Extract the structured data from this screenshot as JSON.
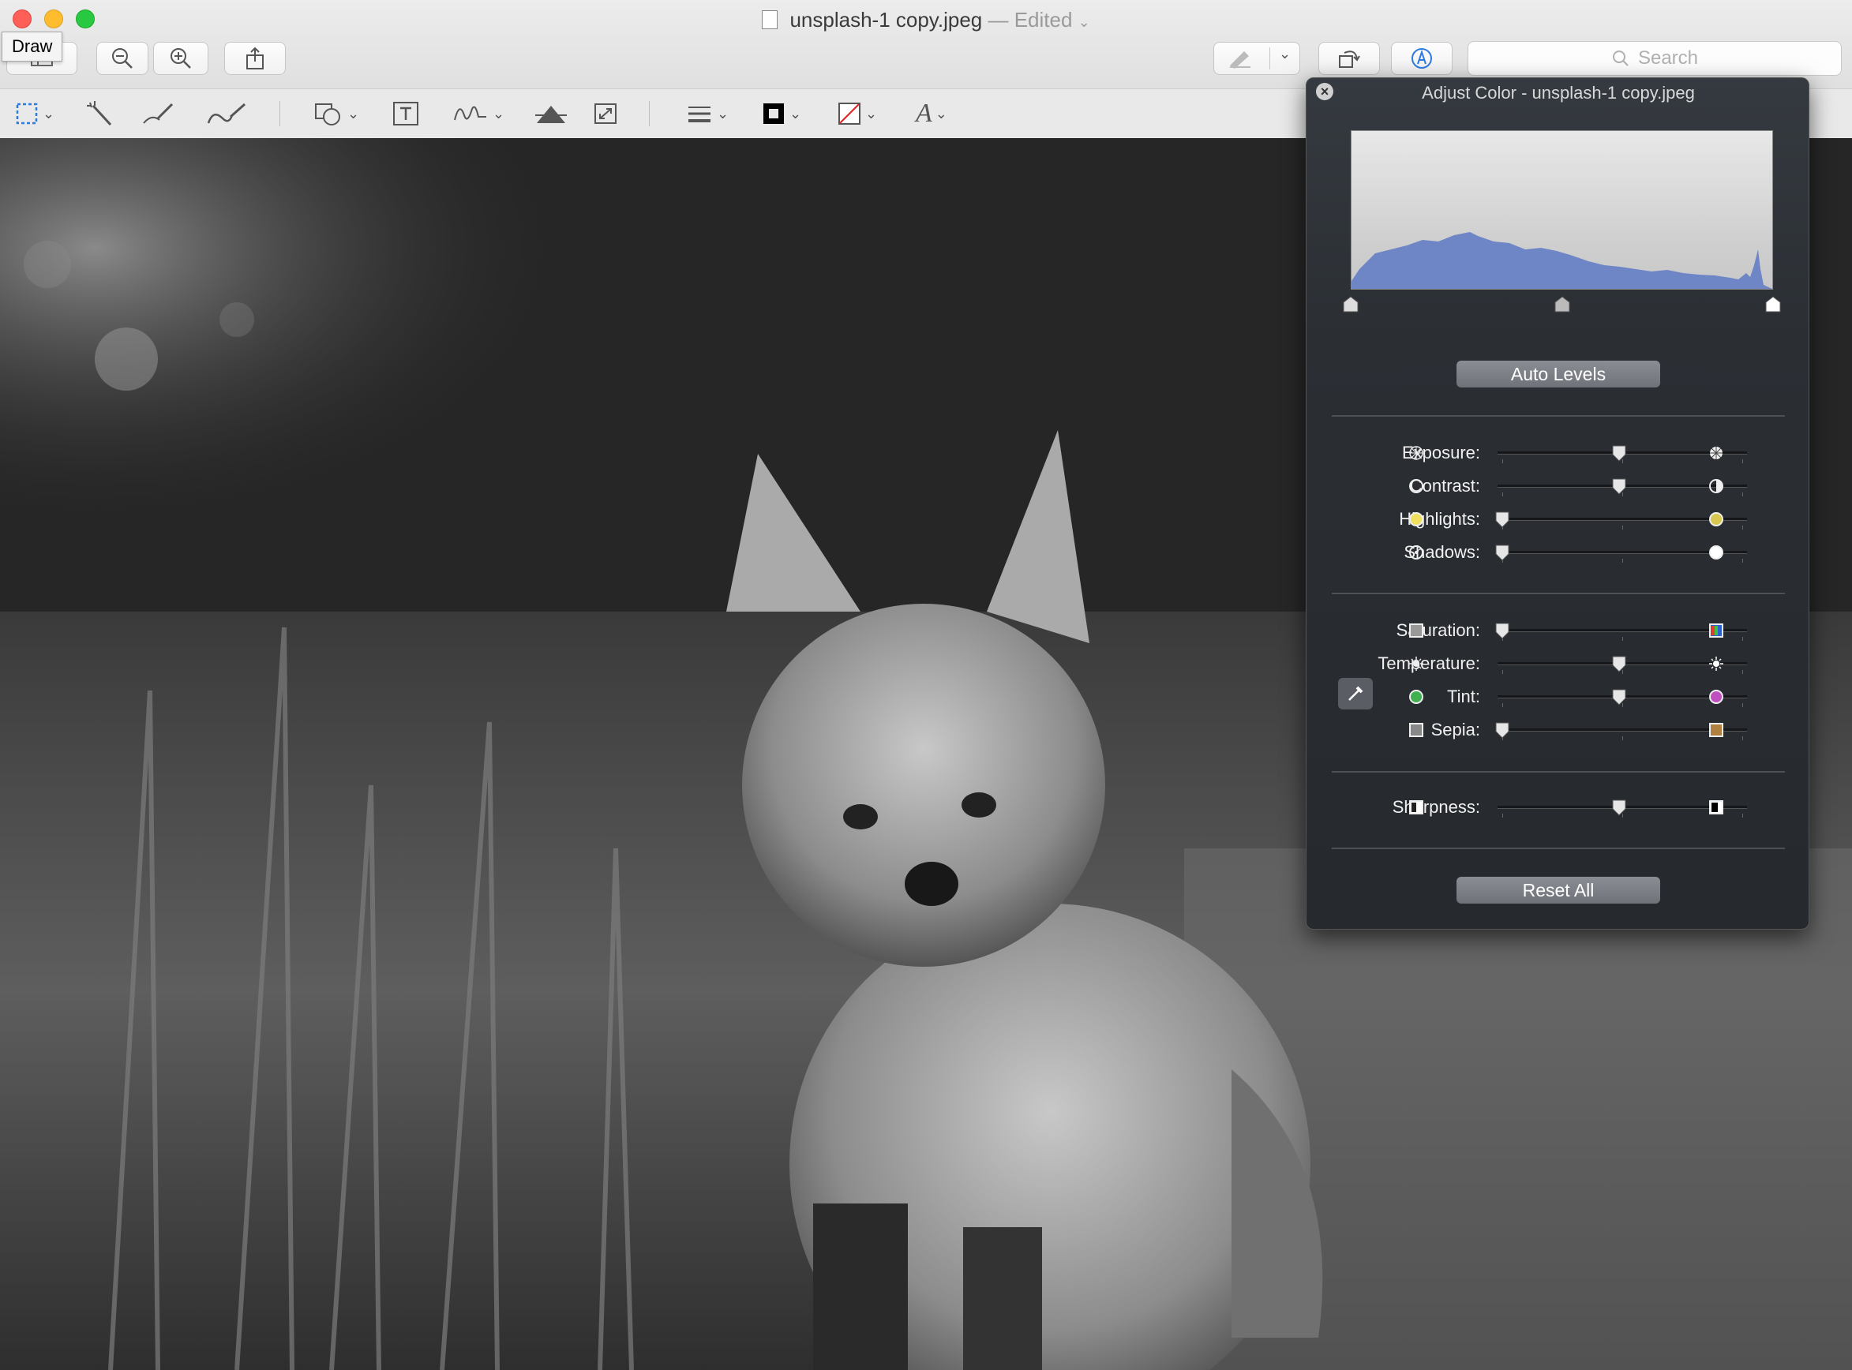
{
  "window": {
    "title": "unsplash-1 copy.jpeg",
    "title_suffix": "— Edited",
    "traffic_colors": [
      "#fe5f57",
      "#febc2e",
      "#28c840"
    ]
  },
  "tooltip": {
    "text": "Draw"
  },
  "toolbar": {
    "search_placeholder": "Search",
    "icons": [
      "sidebar-icon",
      "zoom-out-icon",
      "zoom-in-icon",
      "share-icon",
      "highlight-icon",
      "rotate-icon",
      "markup-icon"
    ]
  },
  "markup_toolbar": {
    "tools": [
      "rect-selection-icon",
      "instant-alpha-icon",
      "sketch-icon",
      "draw-icon",
      "shapes-icon",
      "text-icon",
      "sign-icon",
      "adjust-color-icon",
      "adjust-size-icon",
      "shape-style-icon",
      "border-color-icon",
      "fill-color-icon",
      "text-style-icon"
    ]
  },
  "panel": {
    "title": "Adjust Color - unsplash-1 copy.jpeg",
    "auto_levels": "Auto Levels",
    "reset_all": "Reset All",
    "sliders_group1": [
      {
        "label": "Exposure:",
        "value": 0.5,
        "left_icon": "exposure-low-icon",
        "right_icon": "exposure-high-icon"
      },
      {
        "label": "Contrast:",
        "value": 0.5,
        "left_icon": "contrast-low-icon",
        "right_icon": "contrast-high-icon"
      },
      {
        "label": "Highlights:",
        "value": 0.0,
        "left_icon": "highlights-low-icon",
        "right_icon": "highlights-high-icon"
      },
      {
        "label": "Shadows:",
        "value": 0.0,
        "left_icon": "shadows-low-icon",
        "right_icon": "shadows-high-icon"
      }
    ],
    "sliders_group2": [
      {
        "label": "Saturation:",
        "value": 0.0,
        "left_icon": "saturation-low-icon",
        "right_icon": "saturation-high-icon"
      },
      {
        "label": "Temperature:",
        "value": 0.5,
        "left_icon": "temperature-low-icon",
        "right_icon": "temperature-high-icon"
      },
      {
        "label": "Tint:",
        "value": 0.5,
        "left_icon": "tint-green-icon",
        "right_icon": "tint-magenta-icon"
      },
      {
        "label": "Sepia:",
        "value": 0.0,
        "left_icon": "sepia-low-icon",
        "right_icon": "sepia-high-icon"
      }
    ],
    "sliders_group3": [
      {
        "label": "Sharpness:",
        "value": 0.5,
        "left_icon": "sharpness-low-icon",
        "right_icon": "sharpness-high-icon"
      }
    ],
    "histogram": {
      "black_point": 0.0,
      "midpoint": 0.5,
      "white_point": 1.0,
      "color": "#6f86c6"
    }
  }
}
